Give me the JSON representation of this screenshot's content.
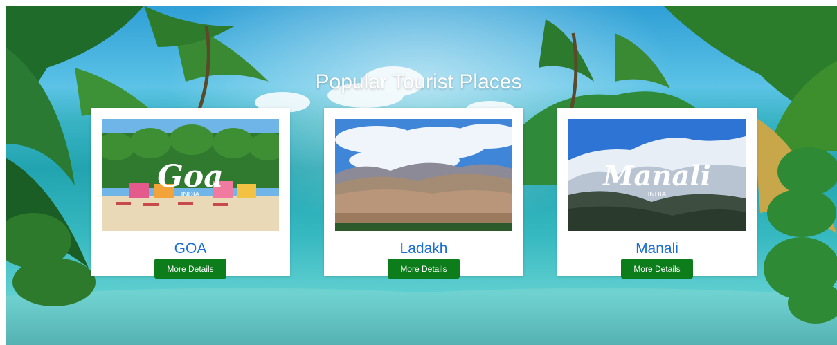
{
  "page": {
    "title": "Popular Tourist Places"
  },
  "places": [
    {
      "name": "GOA",
      "image_script": "Goa",
      "image_caption": "INDIA",
      "button_label": "More Details"
    },
    {
      "name": "Ladakh",
      "image_script": "",
      "image_caption": "",
      "button_label": "More Details"
    },
    {
      "name": "Manali",
      "image_script": "Manali",
      "image_caption": "INDIA",
      "button_label": "More Details"
    }
  ],
  "colors": {
    "title_text": "#ffffff",
    "place_name": "#1a6fd1",
    "button_bg": "#0c7d1a",
    "button_text": "#ffffff",
    "card_bg": "#ffffff"
  },
  "icons": {
    "background": "tropical-beach-background"
  }
}
